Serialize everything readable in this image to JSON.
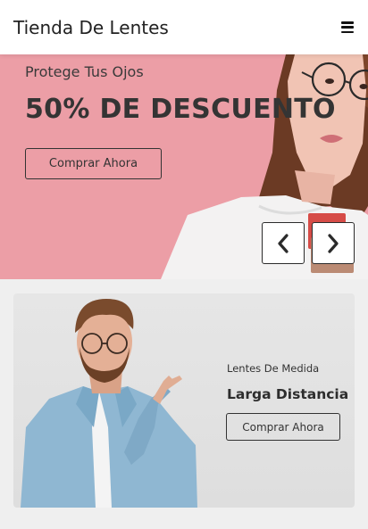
{
  "header": {
    "brand": "Tienda De Lentes",
    "menu_icon": "hamburger-menu-icon"
  },
  "hero": {
    "subtitle": "Protege Tus Ojos",
    "title": "50% DE DESCUENTO",
    "button_label": "Comprar Ahora",
    "prev_icon": "chevron-left-icon",
    "next_icon": "chevron-right-icon",
    "background_color": "#ec9ea6"
  },
  "promo": {
    "subtitle": "Lentes De Medida",
    "title": "Larga Distancia",
    "button_label": "Comprar Ahora"
  }
}
